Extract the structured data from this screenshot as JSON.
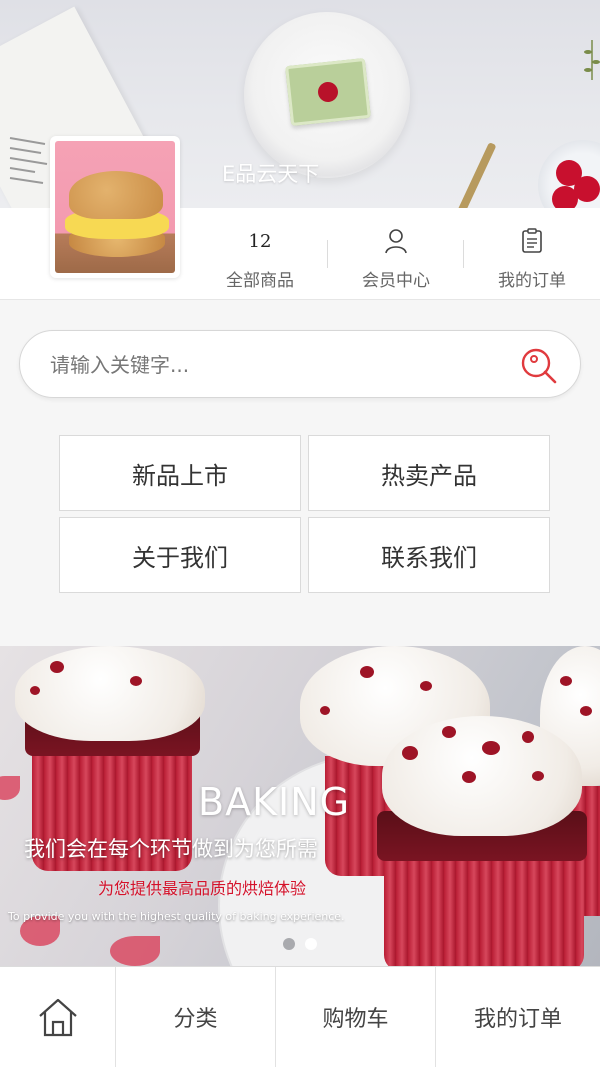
{
  "store": {
    "name": "E品云天下"
  },
  "stats": [
    {
      "value": "12",
      "label": "全部商品",
      "icon": ""
    },
    {
      "value": "",
      "label": "会员中心",
      "icon": "user-icon"
    },
    {
      "value": "",
      "label": "我的订单",
      "icon": "clipboard-icon"
    }
  ],
  "search": {
    "placeholder": "请输入关键字...",
    "icon": "search-icon",
    "accent": "#e03a3e"
  },
  "nav": [
    {
      "label": "新品上市"
    },
    {
      "label": "热卖产品"
    },
    {
      "label": "关于我们"
    },
    {
      "label": "联系我们"
    }
  ],
  "carousel": {
    "title": "BAKING",
    "subtitle": "我们会在每个环节做到为您所需",
    "tagline": "为您提供最高品质的烘焙体验",
    "english": "To provide you with the highest quality of baking experience.",
    "tagline_color": "#d4112a",
    "active_slide": 2,
    "slide_count": 2
  },
  "tabbar": {
    "home_icon": "home-icon",
    "items": [
      {
        "label": "分类"
      },
      {
        "label": "购物车"
      },
      {
        "label": "我的订单"
      }
    ]
  }
}
